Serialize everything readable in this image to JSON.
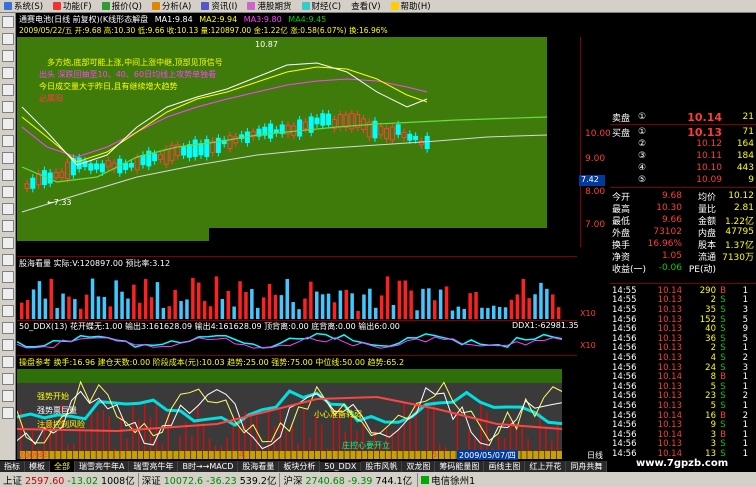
{
  "menubar": {
    "items": [
      "系统(S)",
      "功能(F)",
      "报价(Q)",
      "分析(A)",
      "资讯(I)",
      "港股期货",
      "财经(C)",
      "查看(V)",
      "帮助(H)"
    ]
  },
  "chart": {
    "main_title": "通赛电池(日线 前复权)(K线形态解盘",
    "ma_labels": [
      "MA1:9.84",
      "MA2:9.94",
      "MA3:9.80",
      "MA4:9.45"
    ],
    "info_line": "2009/05/22/五 开:9.68 高:10.30 低:9.66 收:10.13 量:120897.00 金:1.22亿 涨:0.58(6.07%) 换:16.96%",
    "notes": [
      "多方炮,底部可能上涨,中间上涨中继,顶部见顶信号",
      "出头 深跌回抽至10、40、60日均线上攻势单独看",
      "今日成交量大于昨日,且有继续增大趋势",
      "必属阳"
    ],
    "high_marker": "10.87",
    "low_marker": "7.33",
    "price_ticks": [
      "10.00",
      "9.00",
      "8.00",
      "7.00"
    ],
    "current_price_tag": "7.42",
    "vol_title": "股海看量 实际:V:120897.00 预比率:3.12",
    "vol_ticks": [
      "10",
      "X10"
    ],
    "ddx_title": "50_DDX(13)  花开蝶无:1.00  输出3:161628.09  输出4:161628.09  顶背离:0.00  底背离:0.00  输出6:0.00",
    "ddx_right": "DDX1:-62981.35",
    "ind3_title": "操盘参考  换手:16.96  建仓天数:0.00  阶段成本(元):10.03  趋势:25.00  强势:75.00  中位线:50.00  趋势:65.2",
    "ind3_notes": [
      "强势开始",
      "强势票巨量",
      "注意控制风险",
      "小心准备转弱",
      "庄控心要开立"
    ],
    "date_labels": [
      "2009年",
      "4",
      "5",
      "2009/05/07/四",
      "日线"
    ],
    "x10": "X10"
  },
  "quote": {
    "sell": {
      "label": "卖盘",
      "idx": "①",
      "price": "10.14",
      "vol": "21"
    },
    "buy": [
      {
        "label": "买盘",
        "idx": "①",
        "price": "10.13",
        "vol": "71"
      },
      {
        "idx": "②",
        "price": "10.12",
        "vol": "164"
      },
      {
        "idx": "③",
        "price": "10.11",
        "vol": "184"
      },
      {
        "idx": "④",
        "price": "10.10",
        "vol": "443"
      },
      {
        "idx": "⑤",
        "price": "10.09",
        "vol": "9"
      }
    ],
    "stats": [
      {
        "k1": "今开",
        "v1": "9.68",
        "k2": "均价",
        "v2": "10.12"
      },
      {
        "k1": "最高",
        "v1": "10.30",
        "k2": "量比",
        "v2": "2.81"
      },
      {
        "k1": "最低",
        "v1": "9.66",
        "k2": "金额",
        "v2": "1.22亿"
      },
      {
        "k1": "外盘",
        "v1": "73102",
        "k2": "内盘",
        "v2": "47795"
      },
      {
        "k1": "换手",
        "v1": "16.96%",
        "k2": "股本",
        "v2": "1.37亿"
      },
      {
        "k1": "净资",
        "v1": "1.05",
        "k2": "流通",
        "v2": "7130万"
      },
      {
        "k1": "收益(一)",
        "v1": "-0.06",
        "k2": "PE(动)",
        "v2": ""
      }
    ],
    "ticks": [
      {
        "t": "14:55",
        "p": "10.14",
        "v": "290",
        "s": "B",
        "n": "1"
      },
      {
        "t": "14:55",
        "p": "10.13",
        "v": "2",
        "s": "S",
        "n": "1"
      },
      {
        "t": "14:55",
        "p": "10.13",
        "v": "35",
        "s": "S",
        "n": "3"
      },
      {
        "t": "14:56",
        "p": "10.13",
        "v": "152",
        "s": "S",
        "n": "5"
      },
      {
        "t": "14:56",
        "p": "10.13",
        "v": "40",
        "s": "S",
        "n": "9"
      },
      {
        "t": "14:56",
        "p": "10.13",
        "v": "36",
        "s": "S",
        "n": "5"
      },
      {
        "t": "14:56",
        "p": "10.13",
        "v": "2",
        "s": "S",
        "n": "1"
      },
      {
        "t": "14:56",
        "p": "10.13",
        "v": "4",
        "s": "S",
        "n": "2"
      },
      {
        "t": "14:56",
        "p": "10.13",
        "v": "24",
        "s": "S",
        "n": "3"
      },
      {
        "t": "14:56",
        "p": "10.14",
        "v": "8",
        "s": "B",
        "n": "1"
      },
      {
        "t": "14:56",
        "p": "10.13",
        "v": "5",
        "s": "S",
        "n": "1"
      },
      {
        "t": "14:56",
        "p": "10.13",
        "v": "23",
        "s": "S",
        "n": "2"
      },
      {
        "t": "14:56",
        "p": "10.13",
        "v": "5",
        "s": "S",
        "n": "1"
      },
      {
        "t": "14:56",
        "p": "10.14",
        "v": "16",
        "s": "B",
        "n": "2"
      },
      {
        "t": "14:56",
        "p": "10.13",
        "v": "9",
        "s": "S",
        "n": "1"
      },
      {
        "t": "14:56",
        "p": "10.14",
        "v": "3",
        "s": "B",
        "n": "1"
      },
      {
        "t": "14:56",
        "p": "10.13",
        "v": "3",
        "s": "S",
        "n": "1"
      },
      {
        "t": "14:56",
        "p": "10.14",
        "v": "13",
        "s": "S",
        "n": "1"
      }
    ]
  },
  "bottom_tabs": [
    "指标",
    "模板",
    "全部",
    "瑞雪亮牛年A",
    "瑞雪亮牛年",
    "B时→→MACD",
    "股海看量",
    "板块分析",
    "50_DDX",
    "股市风帆",
    "双龙图",
    "筹码能量图",
    "画线主图",
    "红上开花",
    "同舟共舞"
  ],
  "status": {
    "sh_label": "上证",
    "sh_val": "2597.60",
    "sh_chg": "-13.02",
    "sh_amt": "1008亿",
    "sz_label": "深证",
    "sz_val": "10072.6",
    "sz_chg": "-36.23",
    "sz_amt": "539.2亿",
    "hs_label": "沪深",
    "hs_val": "2740.68",
    "hs_chg": "-9.39",
    "hs_amt": "744.1亿",
    "conn": "电信徐州1"
  },
  "watermark": "www.7gpzb.com"
}
